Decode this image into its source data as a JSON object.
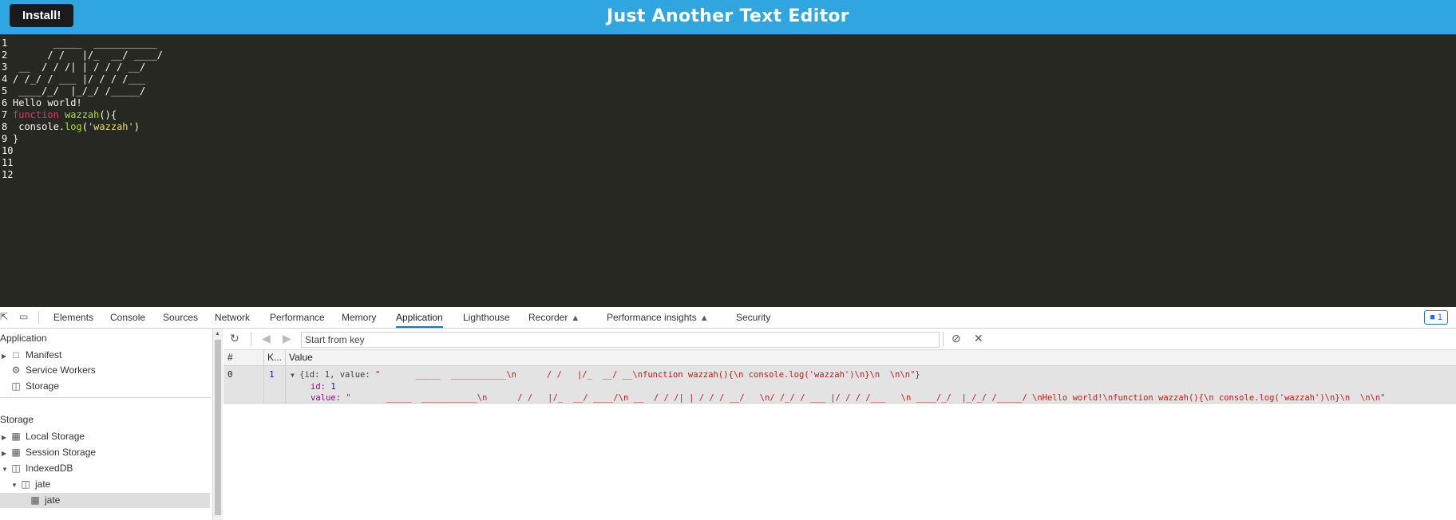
{
  "header": {
    "install_label": "Install!",
    "title": "Just Another Text Editor",
    "bg_color": "#2fa6e0"
  },
  "editor": {
    "lines": [
      {
        "n": "1",
        "text": "       _____  ___________"
      },
      {
        "n": "2",
        "text": "      / /   |/_  __/ ____/"
      },
      {
        "n": "3",
        "text": " __  / / /| | / / / __/"
      },
      {
        "n": "4",
        "text": "/ /_/ / ___ |/ / / /___"
      },
      {
        "n": "5",
        "text": " ____/_/  |_/_/ /_____/"
      },
      {
        "n": "6",
        "text": "Hello world!"
      },
      {
        "n": "7",
        "kw": "function",
        "fn": " wazzah",
        "rest": "(){"
      },
      {
        "n": "8",
        "pre": " console.",
        "fn2": "log",
        "open": "(",
        "str": "'wazzah'",
        "close": ")"
      },
      {
        "n": "9",
        "text": "}"
      },
      {
        "n": "10",
        "text": ""
      },
      {
        "n": "11",
        "text": ""
      },
      {
        "n": "12",
        "text": ""
      }
    ]
  },
  "devtools": {
    "tabs": [
      "Elements",
      "Console",
      "Sources",
      "Network",
      "Performance",
      "Memory",
      "Application",
      "Lighthouse",
      "Recorder",
      "Performance insights",
      "Security"
    ],
    "active_tab": "Application",
    "issues_count": "1",
    "sidebar": {
      "application_heading": "Application",
      "application_items": [
        "Manifest",
        "Service Workers",
        "Storage"
      ],
      "storage_heading": "Storage",
      "storage_items": [
        "Local Storage",
        "Session Storage",
        "IndexedDB",
        "jate",
        "jate"
      ]
    },
    "toolbar": {
      "key_placeholder": "Start from key"
    },
    "grid": {
      "headers": [
        "#",
        "K...",
        "Value"
      ],
      "row": {
        "index": "0",
        "key": "1",
        "summary_prefix": "{id: 1, value: ",
        "summary_value": "\"       _____  ___________\\n      / /   |/_  __/ __\\nfunction wazzah(){\\n console.log('wazzah')\\n}\\n  \\n\\n\"",
        "summary_suffix": "}",
        "id_label": "id",
        "id_value": "1",
        "value_label": "value",
        "value_full": "\"       _____  ___________\\n      / /   |/_  __/ ____/\\n __  / / /| | / / / __/   \\n/ /_/ / ___ |/ / / /___   \\n ____/_/  |_/_/ /_____/ \\nHello world!\\nfunction wazzah(){\\n console.log('wazzah')\\n}\\n  \\n\\n\""
      }
    }
  }
}
